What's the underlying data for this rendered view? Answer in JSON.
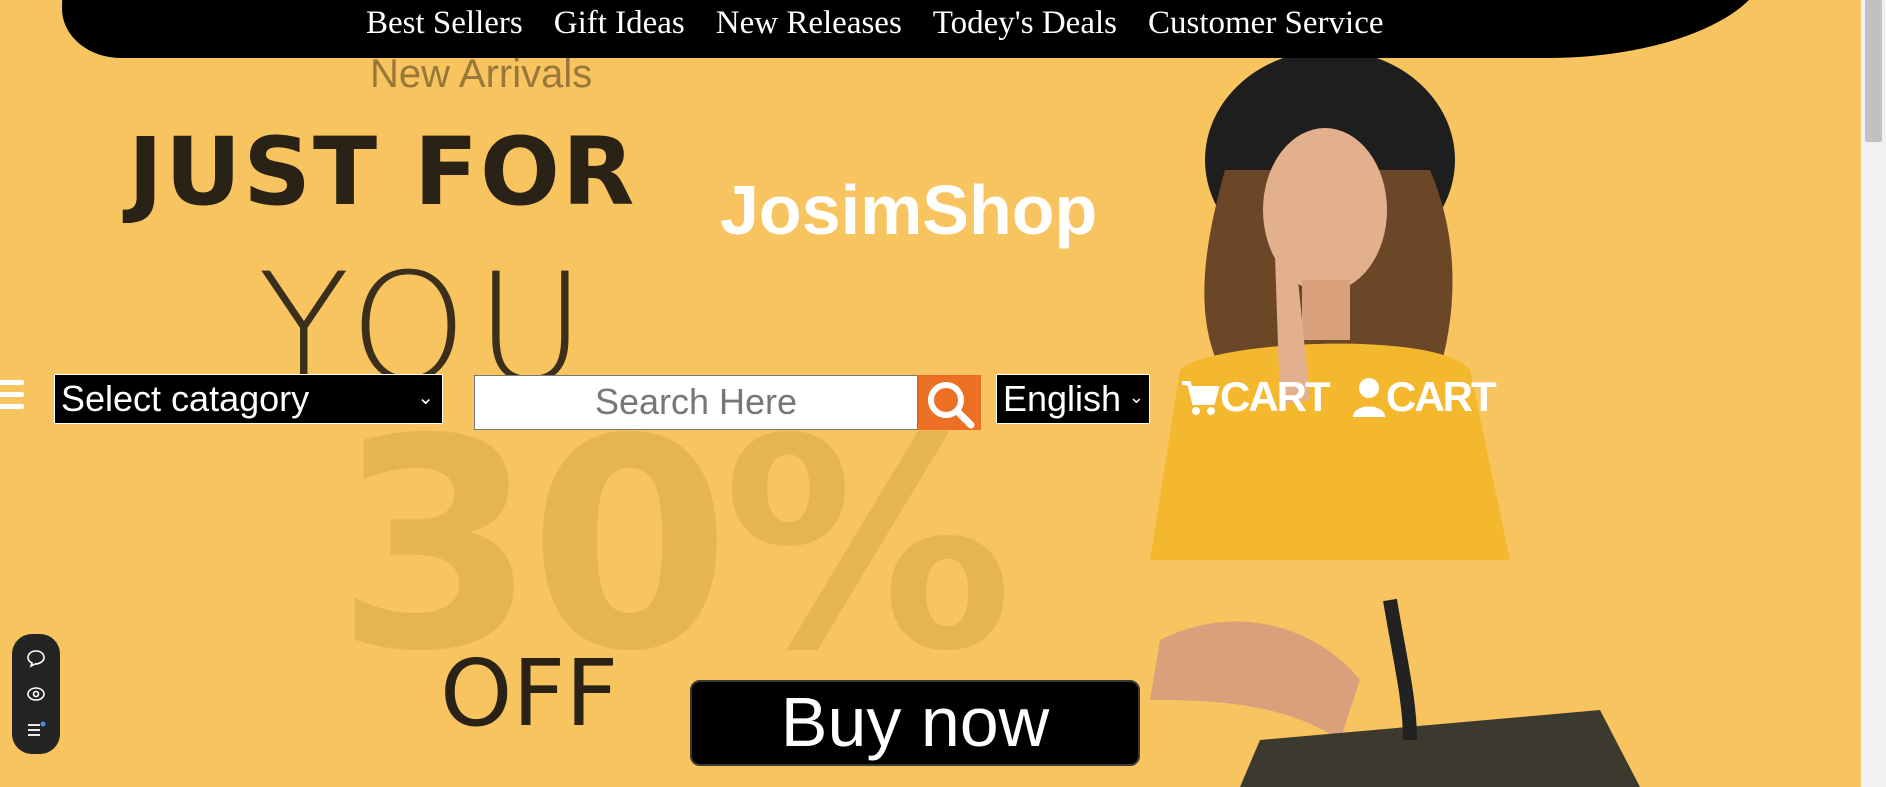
{
  "nav": {
    "links": [
      "Best Sellers",
      "Gift Ideas",
      "New Releases",
      "Todey's Deals",
      "Customer Service"
    ]
  },
  "brand": "JosimShop",
  "promo": {
    "kicker": "New Arrivals",
    "line1": "JUST FOR",
    "line2": "YOU",
    "percent": "30%",
    "line3": "OFF"
  },
  "toolbar": {
    "category_selected": "Select catagory",
    "search_placeholder": "Search Here",
    "language_selected": "English",
    "cart_label": "CART",
    "account_label": "CART"
  },
  "cta": {
    "buy_label": "Buy now"
  },
  "colors": {
    "background": "#f8c45f",
    "accent": "#ed6f24",
    "nav": "#000000"
  }
}
